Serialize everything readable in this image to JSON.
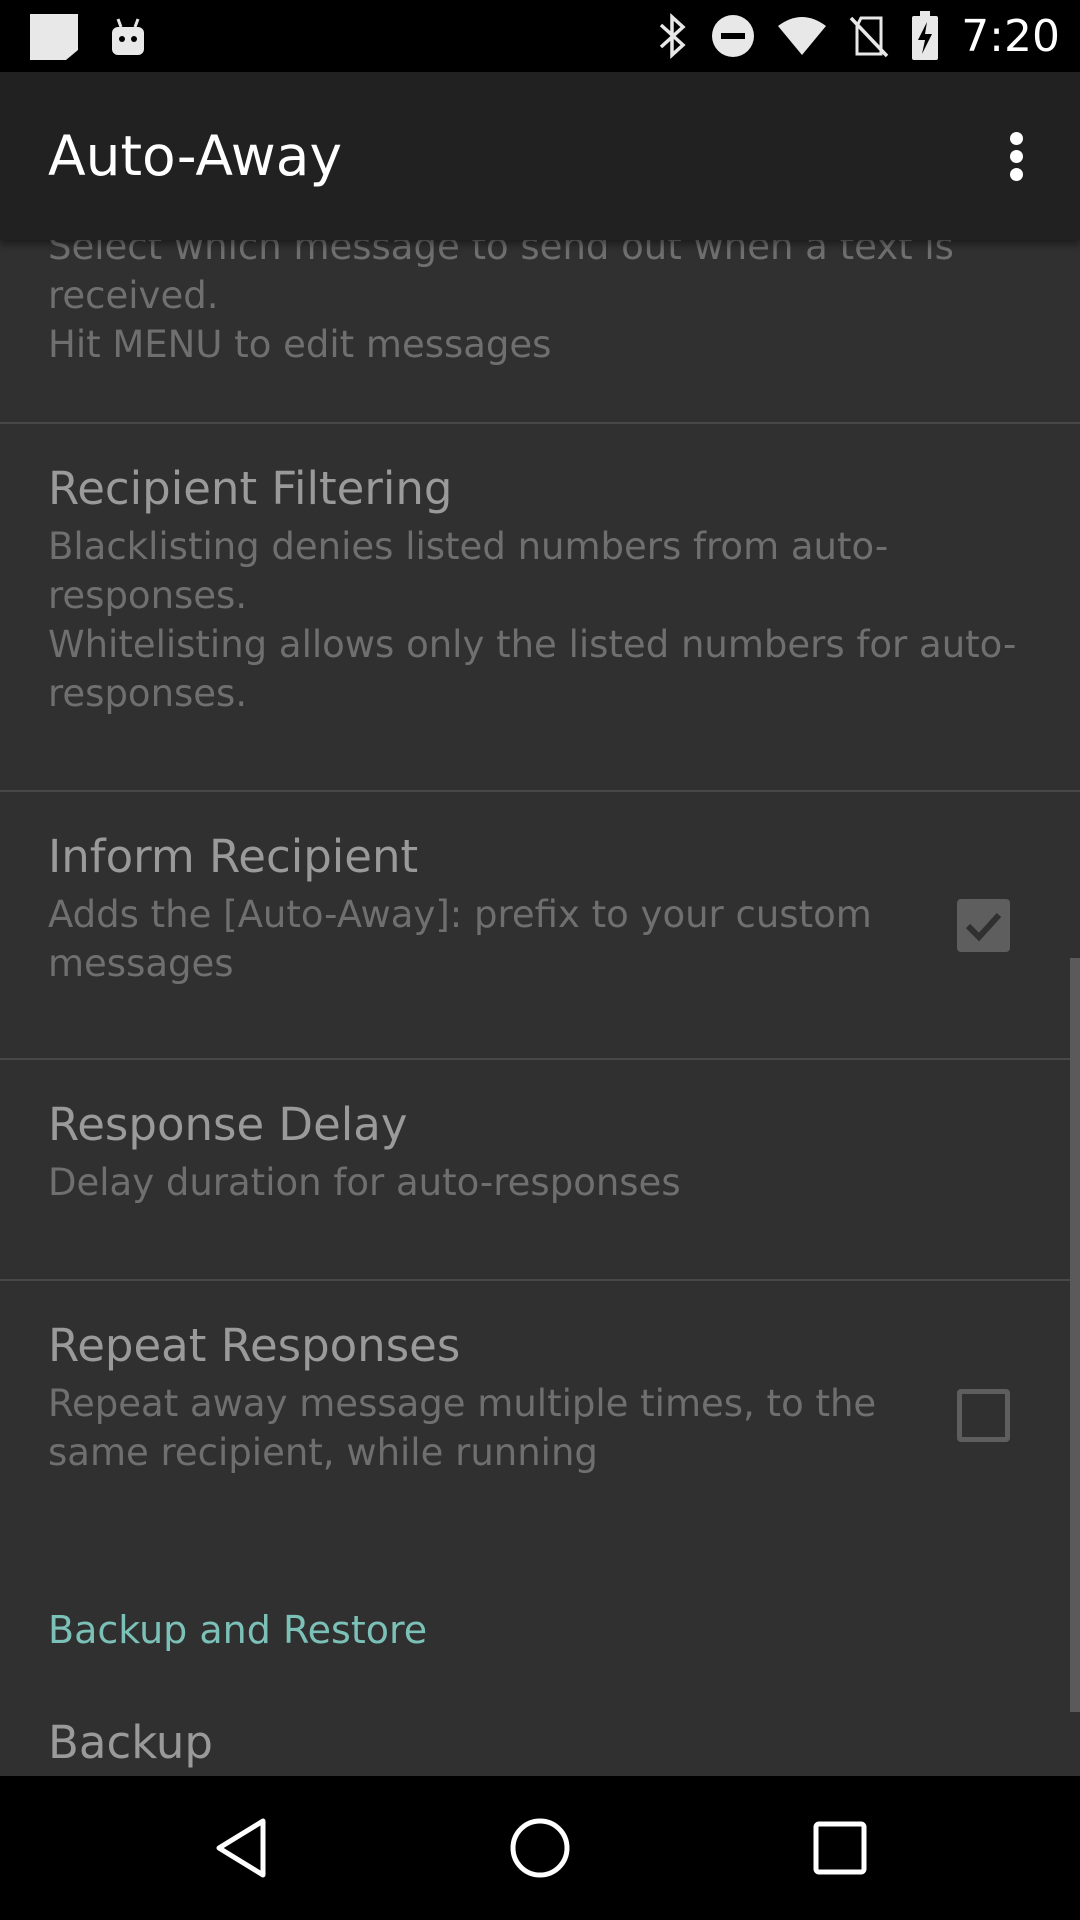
{
  "status_bar": {
    "time": "7:20",
    "icons": [
      "notification-icon",
      "android-debug-icon",
      "bluetooth-icon",
      "do-not-disturb-icon",
      "wifi-icon",
      "no-sim-icon",
      "battery-charging-icon"
    ]
  },
  "app_bar": {
    "title": "Auto-Away",
    "overflow_icon": "more-vert-icon"
  },
  "preferences": [
    {
      "title": "",
      "summary": "Select which message to send out when a text is received.\nHit MENU to edit messages"
    },
    {
      "title": "Recipient Filtering",
      "summary": "Blacklisting denies listed numbers from auto-responses.\nWhitelisting allows only the listed numbers for auto-responses."
    },
    {
      "title": "Inform Recipient",
      "summary": "Adds the [Auto-Away]: prefix to your custom messages",
      "checked": true
    },
    {
      "title": "Response Delay",
      "summary": "Delay duration for auto-responses"
    },
    {
      "title": "Repeat Responses",
      "summary": "Repeat away message multiple times, to the same recipient, while running",
      "checked": false
    }
  ],
  "category": {
    "label": "Backup and Restore"
  },
  "backup": {
    "title": "Backup"
  },
  "colors": {
    "accent": "#7cc1b8",
    "background": "#303030",
    "app_bar": "#212121"
  },
  "nav_bar": {
    "icons": [
      "back-icon",
      "home-icon",
      "recents-icon"
    ]
  }
}
